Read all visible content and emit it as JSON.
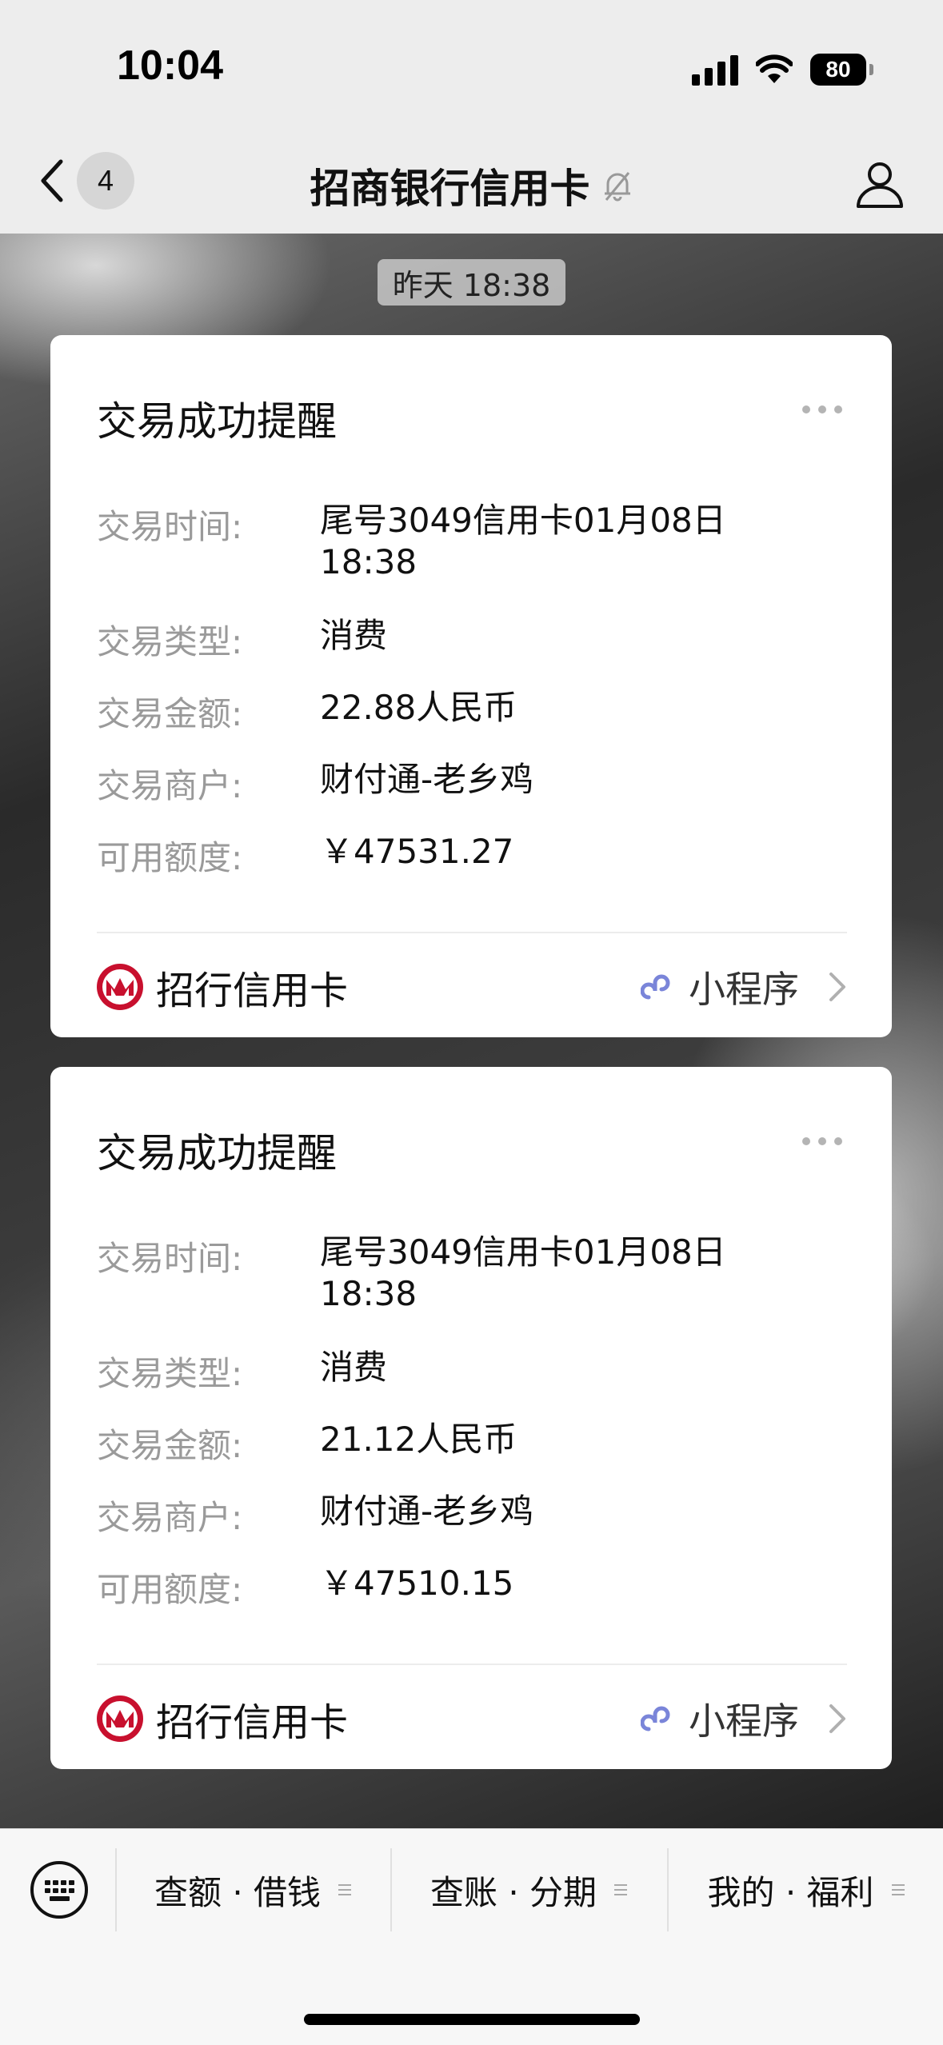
{
  "status_bar": {
    "time": "10:04",
    "battery": "80"
  },
  "nav": {
    "back_count": "4",
    "title": "招商银行信用卡"
  },
  "chat": {
    "timestamp": "昨天 18:38",
    "messages": [
      {
        "title": "交易成功提醒",
        "rows": [
          {
            "label": "交易时间:",
            "value": "尾号3049信用卡01月08日 18:38"
          },
          {
            "label": "交易类型:",
            "value": "消费"
          },
          {
            "label": "交易金额:",
            "value": "22.88人民币"
          },
          {
            "label": "交易商户:",
            "value": "财付通-老乡鸡"
          },
          {
            "label": "可用额度:",
            "value": "￥47531.27"
          }
        ],
        "footer_left": "招行信用卡",
        "footer_right": "小程序"
      },
      {
        "title": "交易成功提醒",
        "rows": [
          {
            "label": "交易时间:",
            "value": "尾号3049信用卡01月08日 18:38"
          },
          {
            "label": "交易类型:",
            "value": "消费"
          },
          {
            "label": "交易金额:",
            "value": "21.12人民币"
          },
          {
            "label": "交易商户:",
            "value": "财付通-老乡鸡"
          },
          {
            "label": "可用额度:",
            "value": "￥47510.15"
          }
        ],
        "footer_left": "招行信用卡",
        "footer_right": "小程序"
      }
    ]
  },
  "bottom_menu": [
    {
      "label": "查额 · 借钱"
    },
    {
      "label": "查账 · 分期"
    },
    {
      "label": "我的 · 福利"
    }
  ],
  "colors": {
    "accent_link": "#7a85d9",
    "brand_red": "#c8102e"
  }
}
